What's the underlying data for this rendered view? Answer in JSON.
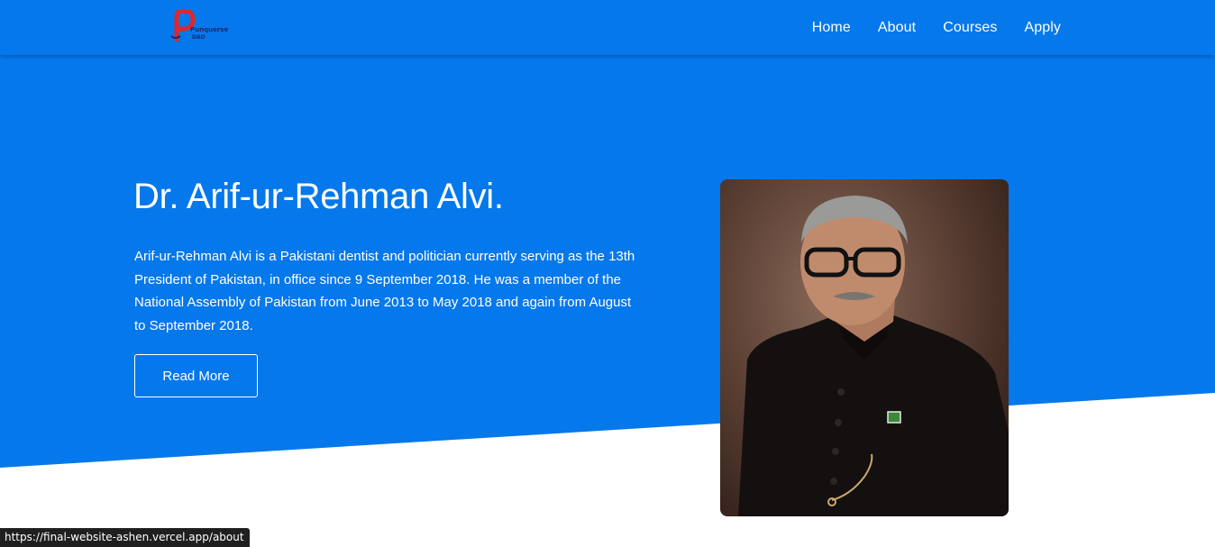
{
  "brand": {
    "logo_text_top": "Punquerse",
    "logo_text_bottom": "DAO",
    "colors": {
      "primary": "#0578eb",
      "logo_red": "#e0262b",
      "logo_navy": "#1a2a6c"
    }
  },
  "nav": {
    "items": [
      {
        "label": "Home"
      },
      {
        "label": "About"
      },
      {
        "label": "Courses"
      },
      {
        "label": "Apply"
      }
    ]
  },
  "hero": {
    "title": "Dr. Arif-ur-Rehman Alvi.",
    "description": "Arif-ur-Rehman Alvi is a Pakistani dentist and politician currently serving as the 13th President of Pakistan, in office since 9 September 2018. He was a member of the National Assembly of Pakistan from June 2013 to May 2018 and again from August to September 2018.",
    "button_label": "Read More",
    "image_alt": "portrait-photo"
  },
  "status_bar": {
    "url": "https://final-website-ashen.vercel.app/about"
  }
}
